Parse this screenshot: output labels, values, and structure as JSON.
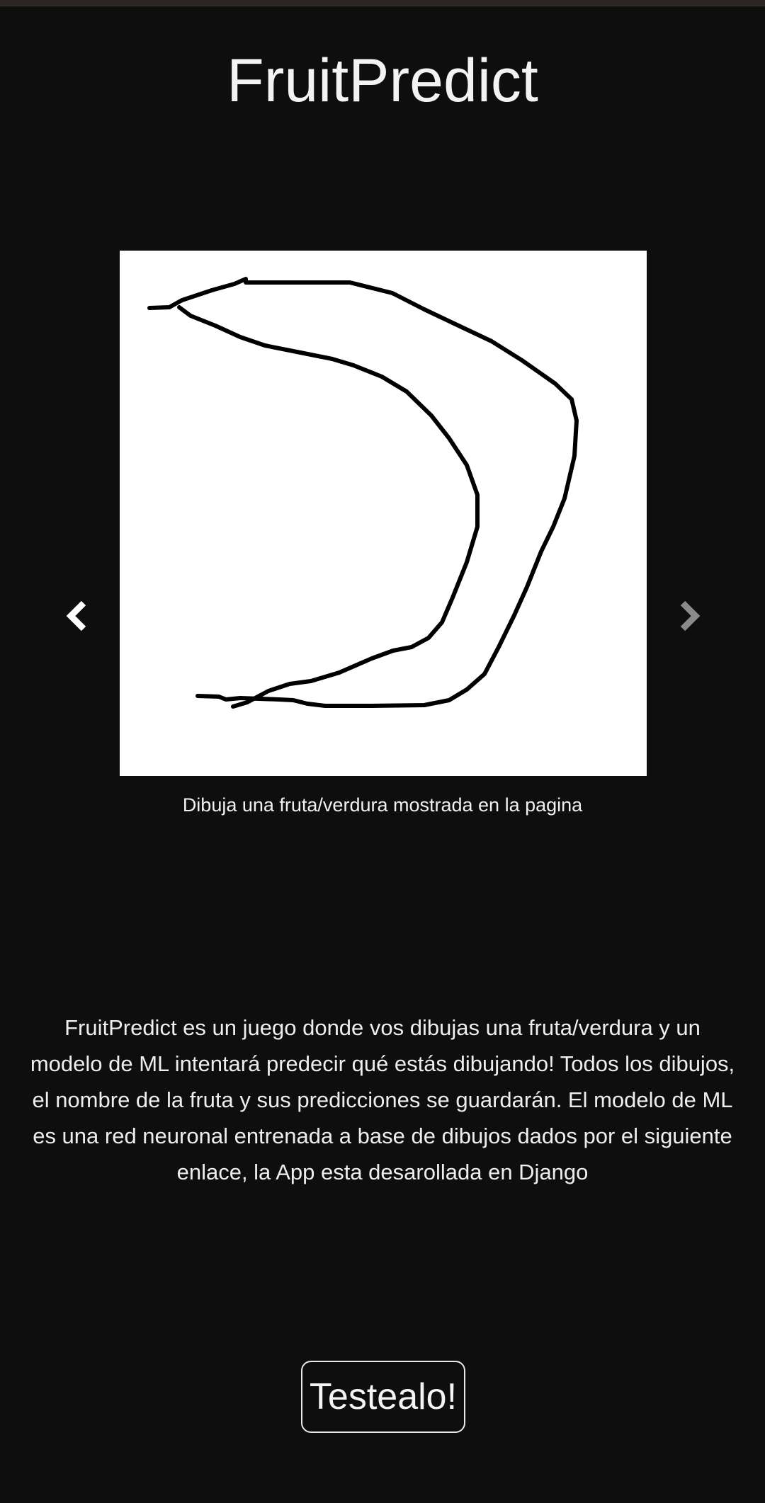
{
  "header": {
    "title": "FruitPredict"
  },
  "carousel": {
    "slide_image": "hand-drawn banana sketch",
    "prev_icon": "chevron-left-icon",
    "next_icon": "chevron-right-icon",
    "caption": "Dibuja una fruta/verdura mostrada en la pagina"
  },
  "intro": {
    "description": "FruitPredict es un juego donde vos dibujas una fruta/verdura y un modelo de ML intentará predecir qué estás dibujando! Todos los dibujos, el nombre de la fruta y sus predicciones se guardarán. El modelo de ML es una red neuronal entrenada a base de dibujos dados por el siguiente enlace, la App esta desarollada en Django"
  },
  "actions": {
    "test_button_label": "Testealo!"
  },
  "colors": {
    "background": "#0e0e0e",
    "text": "#f2f2f2",
    "slide_background": "#ffffff",
    "sketch_stroke": "#000000",
    "next_arrow": "#8a8a8a"
  }
}
